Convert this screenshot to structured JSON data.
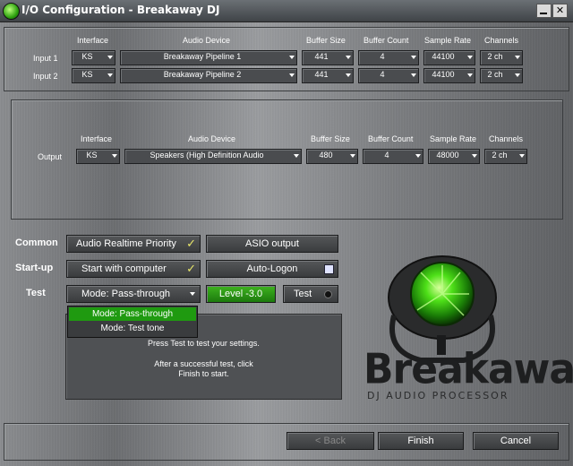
{
  "window": {
    "title": "I/O Configuration - Breakaway DJ",
    "close": "✕"
  },
  "inputs": {
    "headers": {
      "interface": "Interface",
      "device": "Audio Device",
      "buffer_size": "Buffer Size",
      "buffer_count": "Buffer Count",
      "sample_rate": "Sample Rate",
      "channels": "Channels"
    },
    "rows": [
      {
        "label": "Input 1",
        "interface": "KS",
        "device": "Breakaway Pipeline 1",
        "buffer_size": "441",
        "buffer_count": "4",
        "sample_rate": "44100",
        "channels": "2 ch"
      },
      {
        "label": "Input 2",
        "interface": "KS",
        "device": "Breakaway Pipeline 2",
        "buffer_size": "441",
        "buffer_count": "4",
        "sample_rate": "44100",
        "channels": "2 ch"
      }
    ]
  },
  "output": {
    "headers": {
      "interface": "Interface",
      "device": "Audio Device",
      "buffer_size": "Buffer Size",
      "buffer_count": "Buffer Count",
      "sample_rate": "Sample Rate",
      "channels": "Channels"
    },
    "row": {
      "label": "Output",
      "interface": "KS",
      "device": "Speakers (High Definition Audio",
      "buffer_size": "480",
      "buffer_count": "4",
      "sample_rate": "48000",
      "channels": "2 ch"
    }
  },
  "options": {
    "common_label": "Common",
    "startup_label": "Start-up",
    "test_label": "Test",
    "realtime_priority": "Audio Realtime Priority",
    "realtime_checked": "✓",
    "asio_output": "ASIO output",
    "start_with_computer": "Start with computer",
    "start_checked": "✓",
    "auto_logon": "Auto-Logon",
    "test_mode": "Mode: Pass-through",
    "level": "Level -3.0",
    "test_button": "Test"
  },
  "mode_menu": {
    "items": [
      "Mode: Pass-through",
      "Mode: Test tone"
    ],
    "selected": "Mode: Pass-through",
    "highlight_color": "#1f9a10"
  },
  "message": {
    "line1": "Press Test to test your settings.",
    "line2": "After a successful test, click",
    "line3": "Finish to start."
  },
  "logo": {
    "name": "Breakaway",
    "tagline": "DJ AUDIO PROCESSOR",
    "accent": "#3bd41a"
  },
  "footer": {
    "back": "< Back",
    "finish": "Finish",
    "cancel": "Cancel"
  }
}
